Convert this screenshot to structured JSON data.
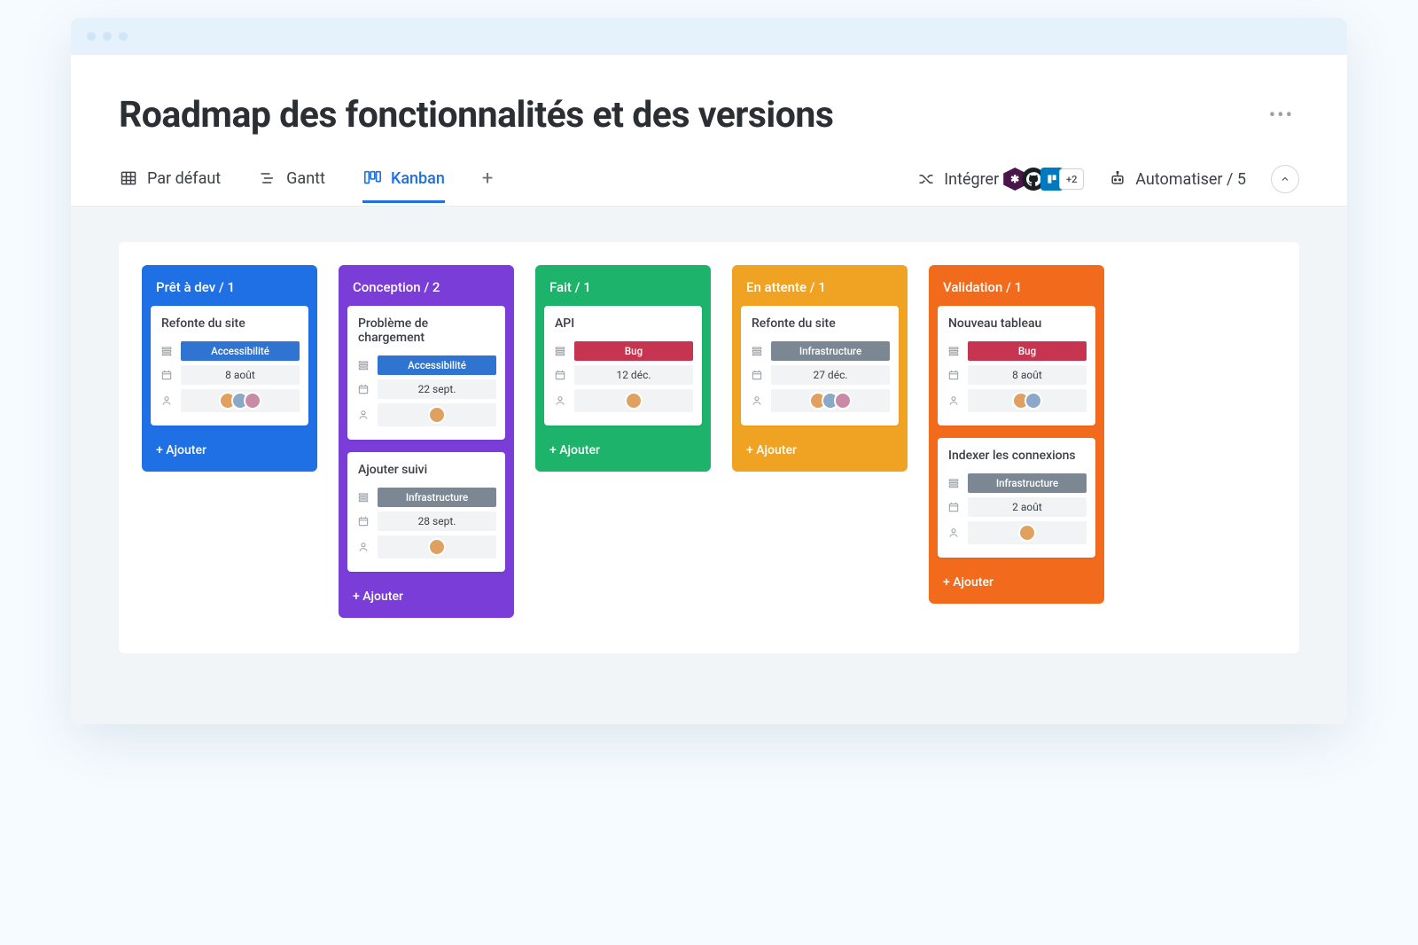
{
  "header": {
    "title": "Roadmap des fonctionnalités et des versions"
  },
  "tabs": {
    "default": "Par défaut",
    "gantt": "Gantt",
    "kanban": "Kanban"
  },
  "toolbar_right": {
    "integrate": "Intégrer",
    "integrations_more": "+2",
    "automate": "Automatiser / 5"
  },
  "columns": [
    {
      "key": "pret",
      "header": "Prêt à dev / 1",
      "color": "blue",
      "add_label": "+ Ajouter",
      "cards": [
        {
          "title": "Refonte du site",
          "tag_text": "Accessibilité",
          "tag_class": "accessibilite",
          "date": "8 août",
          "avatars": 3
        }
      ]
    },
    {
      "key": "conception",
      "header": "Conception / 2",
      "color": "purple",
      "add_label": "+ Ajouter",
      "cards": [
        {
          "title": "Problème de chargement",
          "tag_text": "Accessibilité",
          "tag_class": "accessibilite",
          "date": "22 sept.",
          "avatars": 1
        },
        {
          "title": "Ajouter suivi",
          "tag_text": "Infrastructure",
          "tag_class": "infra",
          "date": "28 sept.",
          "avatars": 1
        }
      ]
    },
    {
      "key": "fait",
      "header": "Fait / 1",
      "color": "green",
      "add_label": "+ Ajouter",
      "cards": [
        {
          "title": "API",
          "tag_text": "Bug",
          "tag_class": "bug",
          "date": "12 déc.",
          "avatars": 1
        }
      ]
    },
    {
      "key": "attente",
      "header": "En attente / 1",
      "color": "amber",
      "add_label": "+ Ajouter",
      "cards": [
        {
          "title": "Refonte du site",
          "tag_text": "Infrastructure",
          "tag_class": "infra",
          "date": "27 déc.",
          "avatars": 3
        }
      ]
    },
    {
      "key": "validation",
      "header": "Validation / 1",
      "color": "orange",
      "add_label": "+ Ajouter",
      "cards": [
        {
          "title": "Nouveau tableau",
          "tag_text": "Bug",
          "tag_class": "bug",
          "date": "8 août",
          "avatars": 2
        },
        {
          "title": "Indexer les connexions",
          "tag_text": "Infrastructure",
          "tag_class": "infra",
          "date": "2 août",
          "avatars": 1
        }
      ]
    }
  ]
}
